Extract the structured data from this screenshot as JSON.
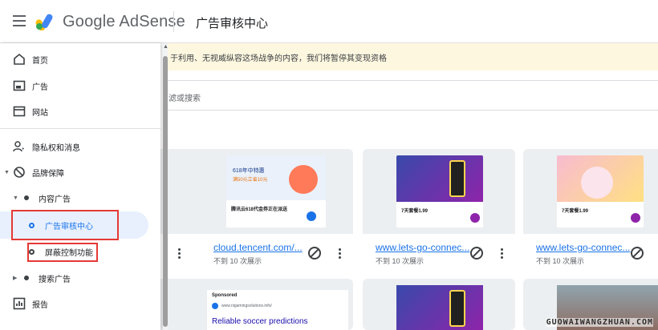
{
  "header": {
    "brand": "Google AdSense",
    "page_title": "广告审核中心"
  },
  "banner": {
    "text": "于利用、无视威纵容这场战争的内容，我们将暂停其变现资格"
  },
  "filter": {
    "text": "滤或搜索"
  },
  "sidebar": {
    "items": [
      {
        "label": "首页",
        "icon": "home-icon"
      },
      {
        "label": "广告",
        "icon": "ads-icon"
      },
      {
        "label": "网站",
        "icon": "sites-icon"
      },
      {
        "label": "隐私权和消息",
        "icon": "privacy-messaging-icon"
      },
      {
        "label": "品牌保障",
        "icon": "block-icon"
      },
      {
        "label": "内容广告"
      },
      {
        "label": "广告审核中心"
      },
      {
        "label": "屏蔽控制功能"
      },
      {
        "label": "搜索广告"
      },
      {
        "label": "报告",
        "icon": "reports-icon"
      }
    ]
  },
  "cards": [
    {
      "url": "",
      "meta": ""
    },
    {
      "url": "cloud.tencent.com/...",
      "meta": "不到 10 次展示",
      "ad_title": "腾讯云618代金券正在派送",
      "ad_headline": "618年中特惠",
      "ad_sub": "满50元立省10元"
    },
    {
      "url": "www.lets-go-connec...",
      "meta": "不到 10 次展示",
      "ad_title": "7天套餐1.99"
    },
    {
      "url": "www.lets-go-connec...",
      "meta": "不到 10 次展示",
      "ad_title": "7天套餐1.99"
    }
  ],
  "bottom_card": {
    "sponsored": "Sponsored",
    "site": "www.nigamingsolutions.info/",
    "headline": "Reliable soccer predictions"
  },
  "watermark": "GUOWAIWANGZHUAN.COM",
  "colors": {
    "accent": "#1a73e8",
    "banner_bg": "#fef7e0",
    "active_bg": "#e8f0fe",
    "highlight": "#e53935"
  }
}
